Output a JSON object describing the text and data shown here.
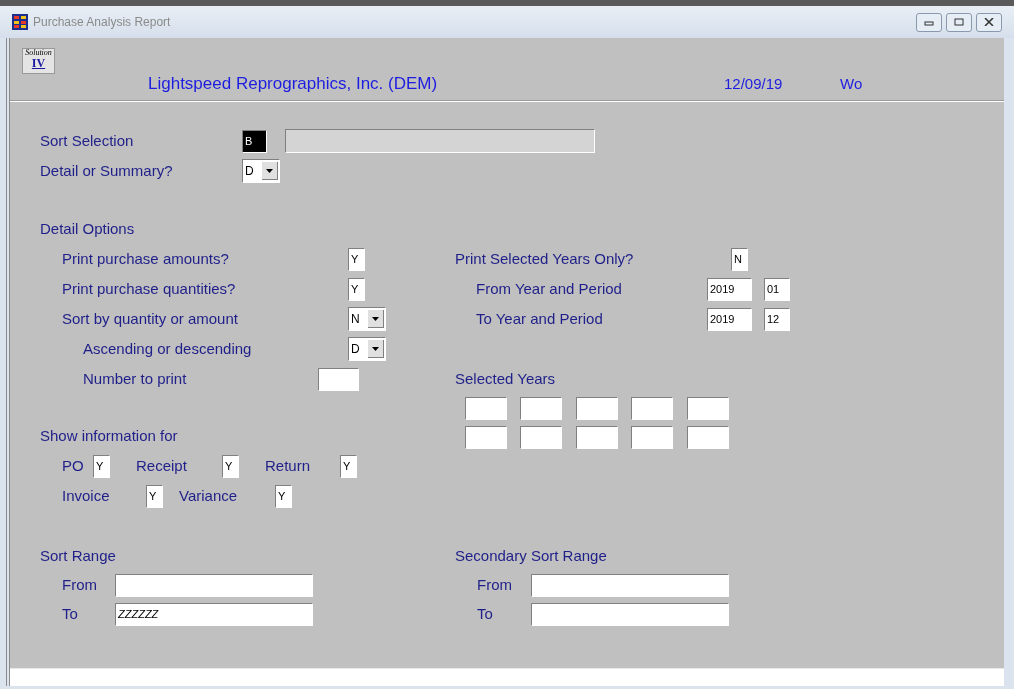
{
  "window": {
    "title": "Purchase Analysis Report"
  },
  "header": {
    "logo": {
      "script": "Solution",
      "numeral": "IV"
    },
    "company": "Lightspeed Reprographics, Inc. (DEM)",
    "date": "12/09/19",
    "user": "Wo"
  },
  "sort_selection": {
    "label": "Sort Selection",
    "value": "B"
  },
  "detail_or_summary": {
    "label": "Detail or Summary?",
    "value": "D"
  },
  "detail_options": {
    "heading": "Detail Options",
    "fields": [
      {
        "label": "Print purchase amounts?",
        "value": "Y",
        "kind": "text"
      },
      {
        "label": "Print purchase quantities?",
        "value": "Y",
        "kind": "text"
      },
      {
        "label": "Sort by quantity or amount",
        "value": "N",
        "kind": "dropdown",
        "children": [
          {
            "label": "Ascending or descending",
            "value": "D",
            "kind": "dropdown"
          },
          {
            "label": "Number to print",
            "kind": "number"
          }
        ]
      }
    ]
  },
  "selected_years_only": {
    "label": "Print Selected Years Only?",
    "value": "N"
  },
  "period_range": [
    {
      "label": "From Year and Period",
      "year": "2019",
      "period": "01"
    },
    {
      "label": "To Year and Period",
      "year": "2019",
      "period": "12"
    }
  ],
  "selected_years": {
    "heading": "Selected Years"
  },
  "show_information_for": {
    "heading": "Show information for",
    "rows": [
      [
        {
          "label": "PO",
          "value": "Y"
        },
        {
          "label": "Receipt",
          "value": "Y"
        },
        {
          "label": "Return",
          "value": "Y"
        }
      ],
      [
        {
          "label": "Invoice",
          "value": "Y"
        },
        {
          "label": "Variance",
          "value": "Y"
        }
      ]
    ]
  },
  "sort_range": {
    "heading": "Sort Range",
    "from": {
      "label": "From"
    },
    "to": {
      "label": "To",
      "value": "ZZZZZZ"
    }
  },
  "secondary_sort_range": {
    "heading": "Secondary Sort Range",
    "from": {
      "label": "From"
    },
    "to": {
      "label": "To"
    }
  }
}
